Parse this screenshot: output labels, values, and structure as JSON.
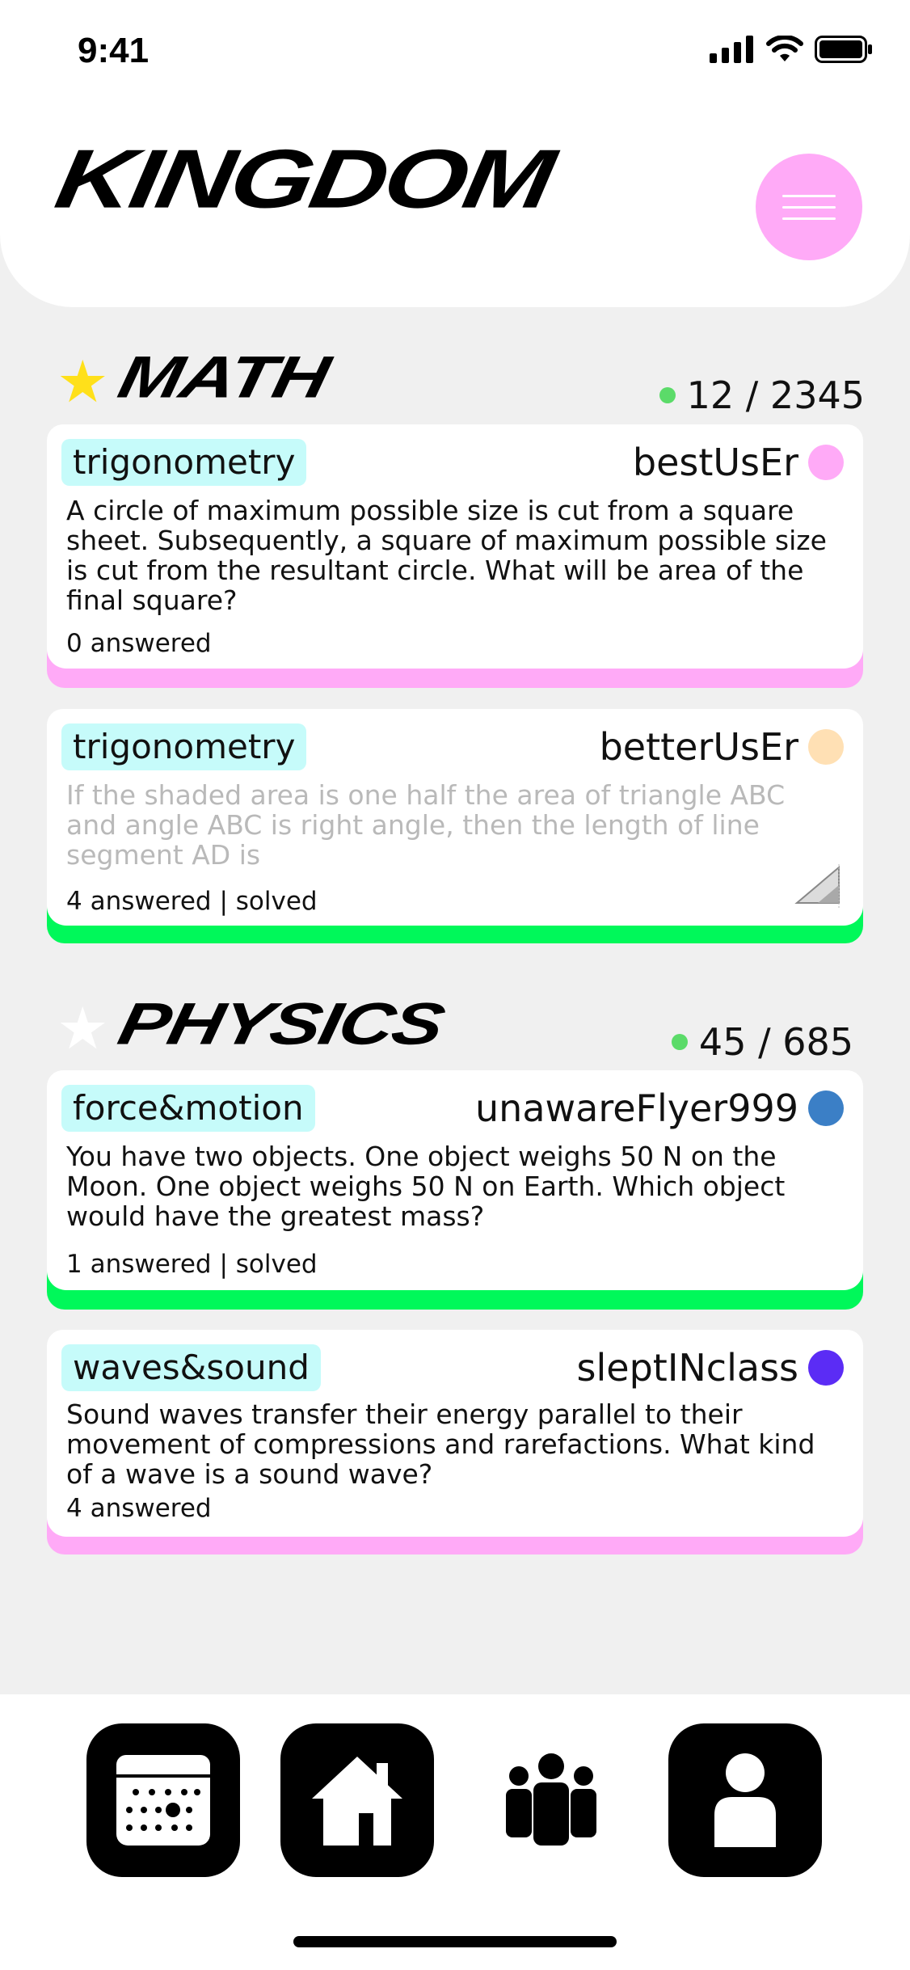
{
  "status_bar": {
    "time": "9:41"
  },
  "header": {
    "brand": "KINGDOM"
  },
  "colors": {
    "accent_pink": "#ffaaf7",
    "accent_green": "#00f85a",
    "tag_bg": "#c6fbfa",
    "online_dot": "#5bdb69",
    "star_yellow": "#ffe01a"
  },
  "sections": [
    {
      "title": "MATH",
      "count": "12 / 2345",
      "starred": true,
      "cards": [
        {
          "tag": "trigonometry",
          "author": "bestUsEr",
          "author_color": "#ffaaf7",
          "question": "A circle of maximum possible size is cut from a square sheet. Subsequently, a square of maximum possible size is cut from the resultant circle. What will be area of the final square?",
          "meta": "0 answered",
          "bar_color": "#ffaaf7",
          "faded": false
        },
        {
          "tag": "trigonometry",
          "author": "betterUsEr",
          "author_color": "#ffe0b4",
          "question": "If the shaded area is one half the area of triangle ABC and angle ABC is right angle, then the length of line segment AD is",
          "meta": "4 answered | solved",
          "bar_color": "#00f85a",
          "faded": true,
          "thumbnail_icon": "triangle-diagram-icon"
        }
      ]
    },
    {
      "title": "PHYSICS",
      "count": "45 / 685",
      "starred": false,
      "cards": [
        {
          "tag": "force&motion",
          "author": "unawareFlyer999",
          "author_color": "#3b7fc6",
          "question": "You have two objects. One object weighs 50 N on the Moon. One object weighs 50 N on Earth. Which object would have the greatest mass?",
          "meta": "1 answered | solved",
          "bar_color": "#00f85a",
          "faded": false
        },
        {
          "tag": "waves&sound",
          "author": "sleptINclass",
          "author_color": "#5b2cf5",
          "question": "Sound waves transfer their energy parallel to their movement of compressions and rarefactions. What kind of a wave is a sound wave?",
          "meta": "4 answered",
          "bar_color": "#ffaaf7",
          "faded": false
        }
      ]
    }
  ],
  "tabbar": {
    "tabs": [
      {
        "icon": "calendar-icon"
      },
      {
        "icon": "home-icon"
      },
      {
        "icon": "community-icon"
      },
      {
        "icon": "profile-icon"
      }
    ]
  }
}
